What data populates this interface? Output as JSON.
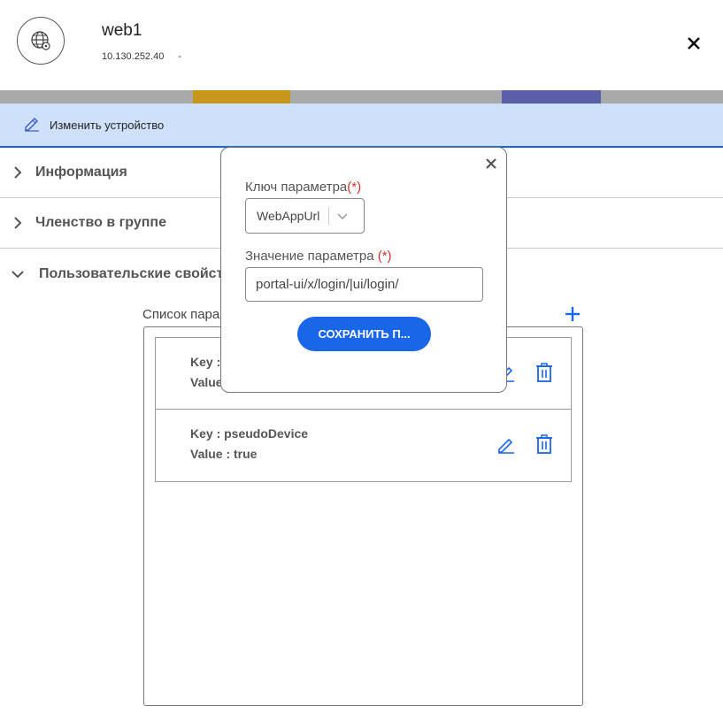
{
  "header": {
    "title": "web1",
    "ip": "10.130.252.40",
    "separator": "-",
    "avatar_icon": "globe-gear-icon",
    "close_icon": "close-icon"
  },
  "edit_bar": {
    "label": "Изменить устройство",
    "icon": "pencil-icon"
  },
  "sections": {
    "info": "Информация",
    "group": "Членство в группе",
    "props": "Пользовательские свойства"
  },
  "list": {
    "label": "Список пара",
    "rows": [
      {
        "key": "Key :",
        "value": "Value"
      },
      {
        "key": "Key : pseudoDevice",
        "value": "Value : true"
      }
    ]
  },
  "dialog": {
    "key_label": "Ключ параметра",
    "required_mark": "(*)",
    "key_value": "WebAppUrl",
    "value_label": "Значение параметра ",
    "value_input": "portal-ui/x/login/|ui/login/",
    "save_label": "СОХРАНИТЬ П..."
  },
  "colors": {
    "accent": "#1a66e8",
    "edit_bar_bg": "#cfe0fa",
    "required": "#d32f2f"
  }
}
